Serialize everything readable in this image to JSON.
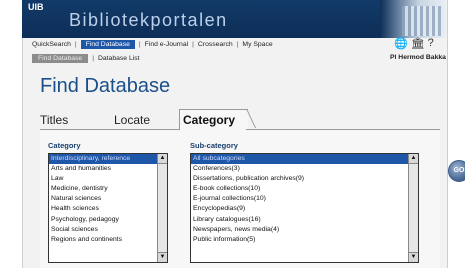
{
  "header": {
    "logo_text": "UIB",
    "portal_title": "Bibliotekportalen"
  },
  "nav": {
    "quicksearch": "QuickSearch",
    "find_database": "Find Database",
    "find_ejournal": "Find e-Journal",
    "crossearch": "Crossearch",
    "my_space": "My Space",
    "separator": "|",
    "icons": [
      "globe-icon",
      "library-icon",
      "help-icon"
    ]
  },
  "subnav": {
    "find_database": "Find Database",
    "database_list": "Database List"
  },
  "user": {
    "name": "Pl Hermod Bakka"
  },
  "page": {
    "title": "Find Database"
  },
  "tabs": {
    "titles": "Titles",
    "locate": "Locate",
    "category": "Category"
  },
  "category": {
    "label": "Category",
    "items": [
      "Interdisciplinary, reference",
      "Arts and humanities",
      "Law",
      "Medicine, dentistry",
      "Natural sciences",
      "Health sciences",
      "Psychology, pedagogy",
      "Social sciences",
      "Regions and continents"
    ],
    "selected_index": 0
  },
  "subcategory": {
    "label": "Sub-category",
    "items": [
      "All subcategories",
      "Conferences(3)",
      "Dissertations, publication archives(9)",
      "E-book collections(10)",
      "E-journal collections(10)",
      "Encyclopedias(9)",
      "Library catalogues(16)",
      "Newspapers, news media(4)",
      "Public information(5)"
    ],
    "selected_index": 0
  },
  "go_button": {
    "label": "GO"
  },
  "colors": {
    "header_bg": "#123a68",
    "accent_blue": "#1f57a8",
    "title_blue": "#1b4f8a",
    "go_blue": "#4e6f99"
  }
}
